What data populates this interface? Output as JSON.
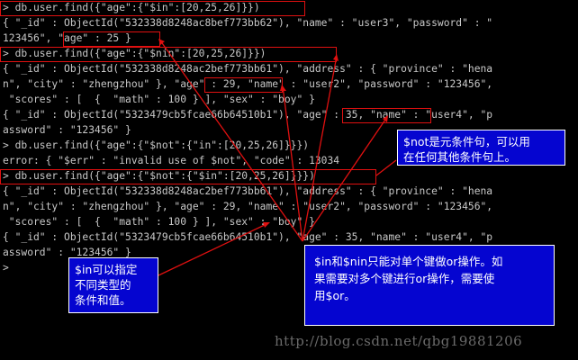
{
  "console": {
    "lines": [
      "> db.user.find({\"age\":{\"$in\":[20,25,26]}})",
      "{ \"_id\" : ObjectId(\"532338d8248ac8bef773bb62\"), \"name\" : \"user3\", \"password\" : \"",
      "123456\", \"age\" : 25 }",
      "> db.user.find({\"age\":{\"$nin\":[20,25,26]}})",
      "{ \"_id\" : ObjectId(\"532338d8248ac2bef773bb61\"), \"address\" : { \"province\" : \"hena",
      "n\", \"city\" : \"zhengzhou\" }, \"age\" : 29, \"name\" : \"user2\", \"password\" : \"123456\",",
      " \"scores\" : [  {  \"math\" : 100 } ], \"sex\" : \"boy\" }",
      "{ \"_id\" : ObjectId(\"5323479cb5fcae66b64510b1\"), \"age\" : 35, \"name\" : \"user4\", \"p",
      "assword\" : \"123456\" }",
      "> db.user.find({\"age\":{\"$not\":{\"in\":[20,25,26]}}})",
      "error: { \"$err\" : \"invalid use of $not\", \"code\" : 13034",
      "> db.user.find({\"age\":{\"$not\":{\"$in\":[20,25,26]}}})",
      "{ \"_id\" : ObjectId(\"532338d8248ac2bef773bb61\"), \"address\" : { \"province\" : \"hena",
      "n\", \"city\" : \"zhengzhou\" }, \"age\" : 29, \"name\" : \"user2\", \"password\" : \"123456\",",
      " \"scores\" : [  {  \"math\" : 100 } ], \"sex\" : \"boy\" }",
      "{ \"_id\" : ObjectId(\"5323479cb5fcae66b64510b1\"), \"age\" : 35, \"name\" : \"user4\", \"p",
      "assword\" : \"123456\" }",
      ">"
    ]
  },
  "notes": {
    "not_note": "$not是元条件句，可以用\n在任何其他条件句上。",
    "in_note": "$in可以指定\n不同类型的\n条件和值。",
    "in_nin_note": "$in和$nin只能对单个键做or操作。如\n果需要对多个键进行or操作，需要使\n用$or。"
  },
  "watermark": "http://blog.csdn.net/qbg19881206",
  "colors": {
    "console_bg": "#000000",
    "console_text": "#c8c8c8",
    "highlight": "#e01010",
    "note_bg": "#0505d0",
    "arrow": "#e01010"
  }
}
